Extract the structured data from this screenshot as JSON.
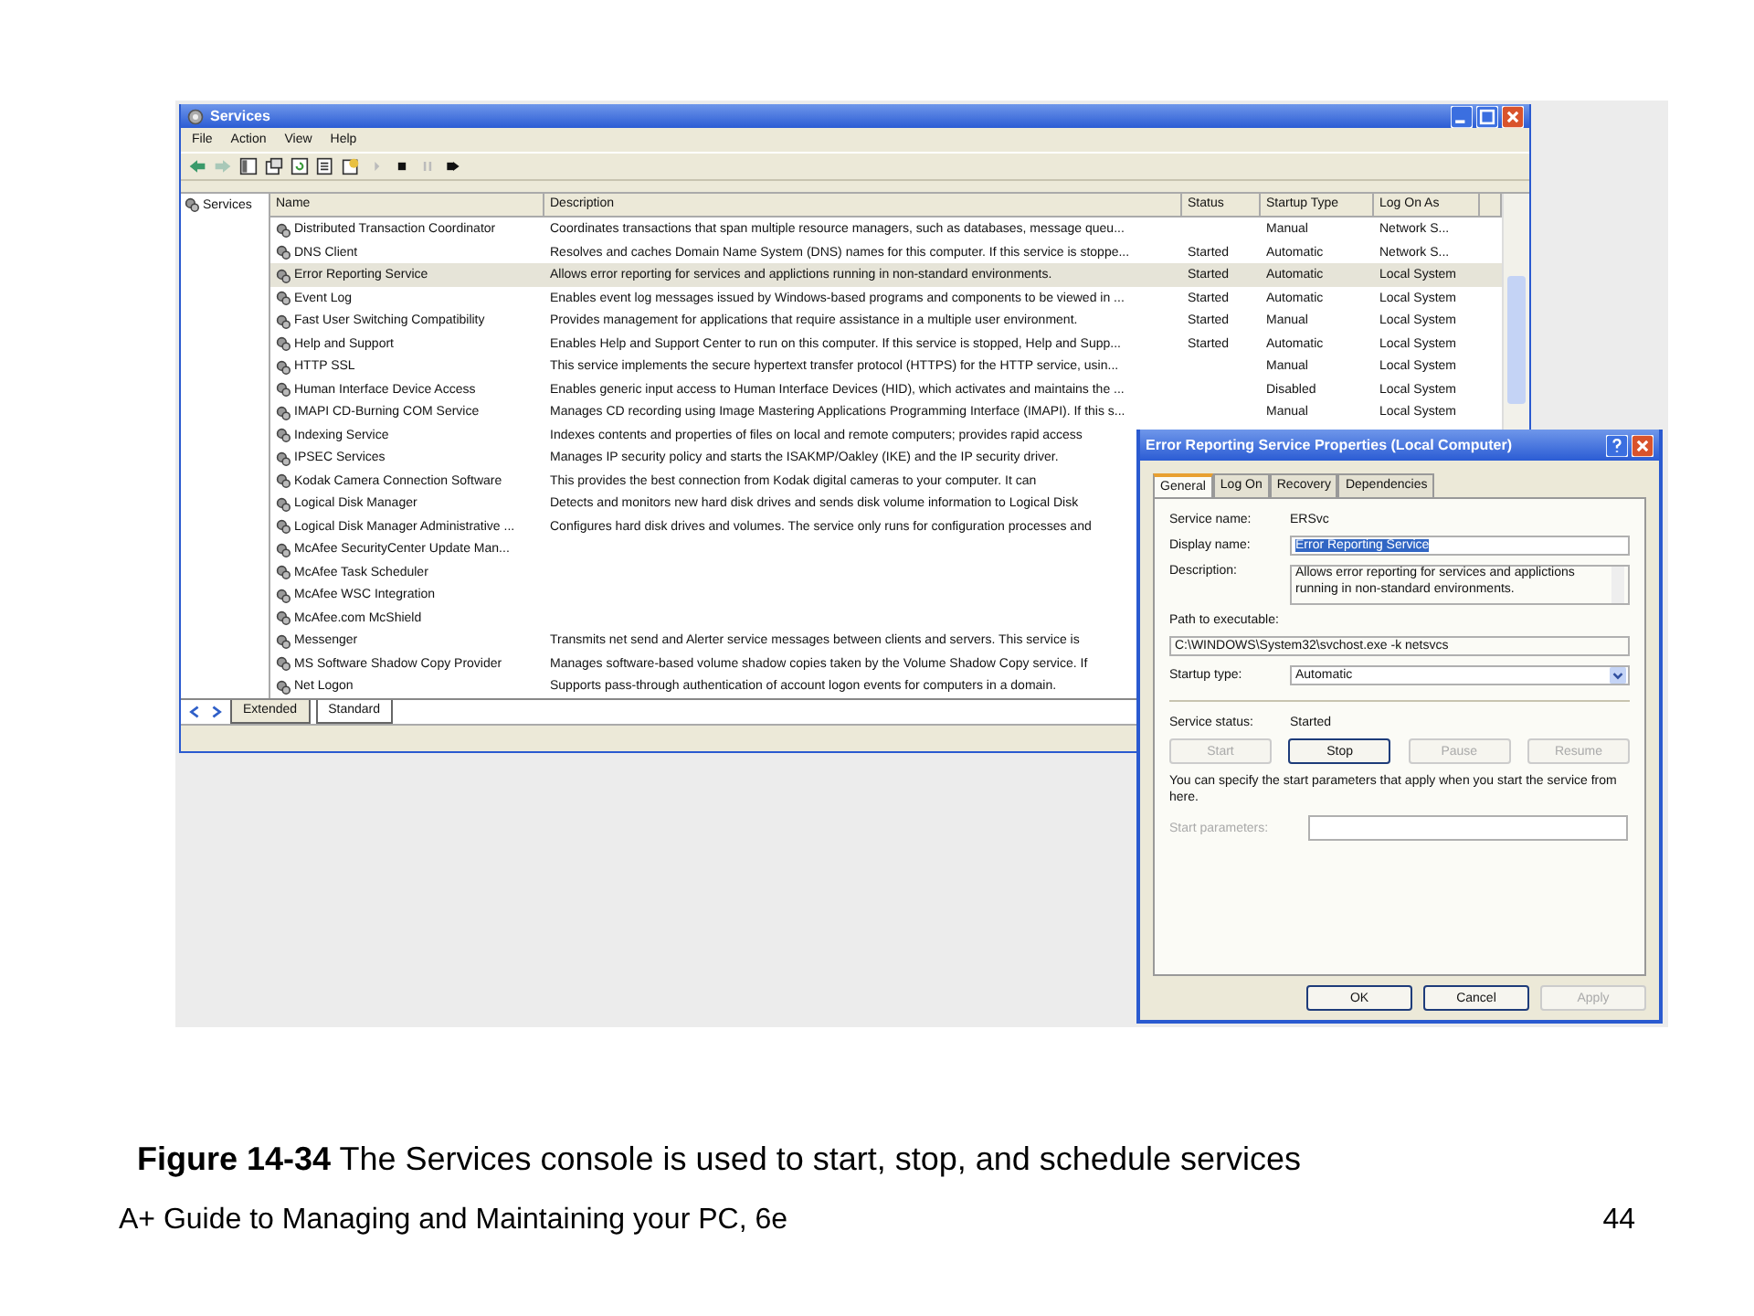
{
  "services_window": {
    "title": "Services",
    "menu": [
      "File",
      "Action",
      "View",
      "Help"
    ],
    "tree": {
      "label": "Services"
    },
    "columns": [
      "Name",
      "Description",
      "Status",
      "Startup Type",
      "Log On As"
    ],
    "rows": [
      {
        "name": "Distributed Transaction Coordinator",
        "description": "Coordinates transactions that span multiple resource managers, such as databases, message queu...",
        "startup_type": "Manual",
        "log_on_as": "Network S...",
        "selected": false
      },
      {
        "name": "DNS Client",
        "description": "Resolves and caches Domain Name System (DNS) names for this computer. If this service is stoppe...",
        "status": "Started",
        "startup_type": "Automatic",
        "log_on_as": "Network S...",
        "selected": false
      },
      {
        "name": "Error Reporting Service",
        "description": "Allows error reporting for services and applictions running in non-standard environments.",
        "status": "Started",
        "startup_type": "Automatic",
        "log_on_as": "Local System",
        "selected": true
      },
      {
        "name": "Event Log",
        "description": "Enables event log messages issued by Windows-based programs and components to be viewed in ...",
        "status": "Started",
        "startup_type": "Automatic",
        "log_on_as": "Local System",
        "selected": false
      },
      {
        "name": "Fast User Switching Compatibility",
        "description": "Provides management for applications that require assistance in a multiple user environment.",
        "status": "Started",
        "startup_type": "Manual",
        "log_on_as": "Local System",
        "selected": false
      },
      {
        "name": "Help and Support",
        "description": "Enables Help and Support Center to run on this computer. If this service is stopped, Help and Supp...",
        "status": "Started",
        "startup_type": "Automatic",
        "log_on_as": "Local System",
        "selected": false
      },
      {
        "name": "HTTP SSL",
        "description": "This service implements the secure hypertext transfer protocol (HTTPS) for the HTTP service, usin...",
        "startup_type": "Manual",
        "log_on_as": "Local System",
        "selected": false
      },
      {
        "name": "Human Interface Device Access",
        "description": "Enables generic input access to Human Interface Devices (HID), which activates and maintains the ...",
        "startup_type": "Disabled",
        "log_on_as": "Local System",
        "selected": false
      },
      {
        "name": "IMAPI CD-Burning COM Service",
        "description": "Manages CD recording using Image Mastering Applications Programming Interface (IMAPI). If this s...",
        "startup_type": "Manual",
        "log_on_as": "Local System",
        "selected": false
      },
      {
        "name": "Indexing Service",
        "description": "Indexes contents and properties of files on local and remote computers; provides rapid access",
        "selected": false
      },
      {
        "name": "IPSEC Services",
        "description": "Manages IP security policy and starts the ISAKMP/Oakley (IKE) and the IP security driver.",
        "selected": false
      },
      {
        "name": "Kodak Camera Connection Software",
        "description": "This provides the best connection from Kodak digital cameras to your computer. It can",
        "selected": false
      },
      {
        "name": "Logical Disk Manager",
        "description": "Detects and monitors new hard disk drives and sends disk volume information to Logical Disk",
        "selected": false
      },
      {
        "name": "Logical Disk Manager Administrative ...",
        "description": "Configures hard disk drives and volumes. The service only runs for configuration processes and",
        "selected": false
      },
      {
        "name": "McAfee SecurityCenter Update Man...",
        "selected": false
      },
      {
        "name": "McAfee Task Scheduler",
        "selected": false
      },
      {
        "name": "McAfee WSC Integration",
        "selected": false
      },
      {
        "name": "McAfee.com McShield",
        "selected": false
      },
      {
        "name": "Messenger",
        "description": "Transmits net send and Alerter service messages between clients and servers. This service is",
        "selected": false
      },
      {
        "name": "MS Software Shadow Copy Provider",
        "description": "Manages software-based volume shadow copies taken by the Volume Shadow Copy service. If",
        "selected": false
      },
      {
        "name": "Net Logon",
        "description": "Supports pass-through authentication of account logon events for computers in a domain.",
        "selected": false
      }
    ],
    "view_tabs": [
      {
        "label": "Extended",
        "selected": false
      },
      {
        "label": "Standard",
        "selected": true
      }
    ]
  },
  "dialog": {
    "title": "Error Reporting Service Properties (Local Computer)",
    "tabs": [
      {
        "label": "General",
        "selected": true
      },
      {
        "label": "Log On",
        "selected": false
      },
      {
        "label": "Recovery",
        "selected": false
      },
      {
        "label": "Dependencies",
        "selected": false
      }
    ],
    "service_name": {
      "label": "Service name:",
      "value": "ERSvc"
    },
    "display_name": {
      "label": "Display name:",
      "value": "Error Reporting Service"
    },
    "description": {
      "label": "Description:",
      "value": "Allows error reporting for services and applictions running in non-standard environments."
    },
    "path": {
      "label": "Path to executable:",
      "value": "C:\\WINDOWS\\System32\\svchost.exe -k netsvcs"
    },
    "startup_type": {
      "label": "Startup type:",
      "value": "Automatic"
    },
    "service_status": {
      "label": "Service status:",
      "value": "Started"
    },
    "control_buttons": [
      {
        "label": "Start",
        "disabled": true
      },
      {
        "label": "Stop",
        "disabled": false
      },
      {
        "label": "Pause",
        "disabled": true
      },
      {
        "label": "Resume",
        "disabled": true
      }
    ],
    "note": "You can specify the start parameters that apply when you start the service from here.",
    "start_parameters": {
      "label": "Start parameters:",
      "disabled": true
    },
    "buttons": [
      {
        "label": "OK",
        "disabled": false
      },
      {
        "label": "Cancel",
        "disabled": false
      },
      {
        "label": "Apply",
        "disabled": true
      }
    ]
  },
  "caption": "**Figure 14-34** The Services console is used to start, stop, and schedule services",
  "footer": {
    "title": "A+ Guide to Managing and Maintaining your PC, 6e",
    "page": "44"
  }
}
